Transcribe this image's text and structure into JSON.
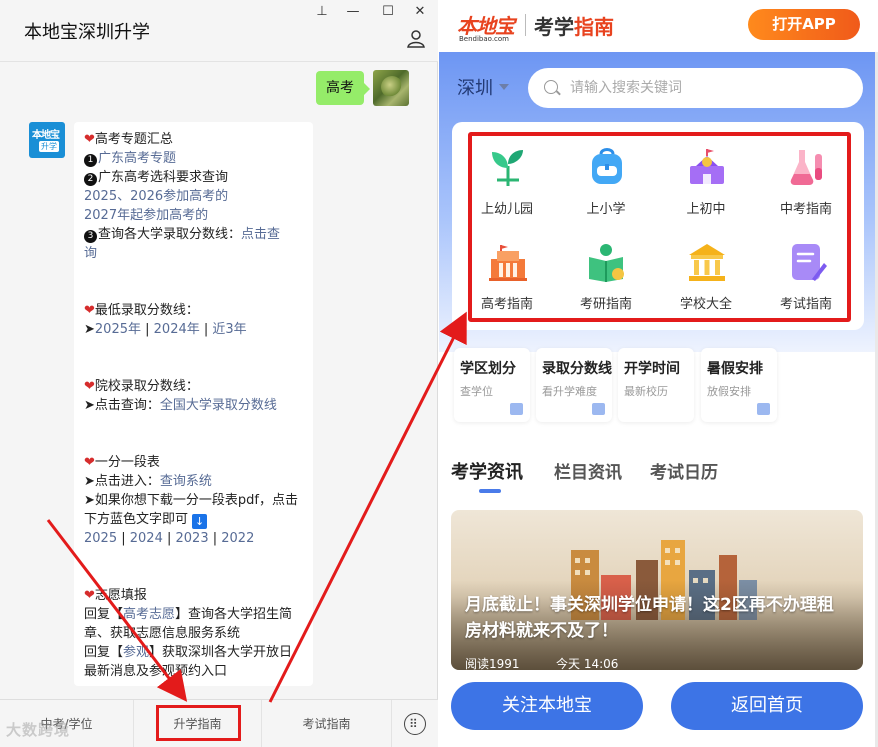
{
  "chat": {
    "title": "本地宝深圳升学",
    "window_controls": [
      "⊥",
      "—",
      "☐",
      "✕"
    ],
    "sent_message": "高考",
    "bot_avatar_text": [
      "本地宝",
      "升学"
    ],
    "lines": {
      "h1": "高考专题汇总",
      "l1": "广东高考专题",
      "l2": "广东高考选科要求查询",
      "l3": "2025、2026参加高考的",
      "l4": "2027年起参加高考的",
      "l5a": "查询各大学录取分数线：",
      "l5b": "点击查",
      "l5c": "询",
      "h2": "最低录取分数线：",
      "l6a": "➤",
      "l6b": "2025年",
      "l6c": "2024年",
      "l6d": "近3年",
      "h3": "院校录取分数线：",
      "l7a": "➤点击查询：",
      "l7b": "全国大学录取分数线",
      "h4": "一分一段表",
      "l8a": "➤点击进入：",
      "l8b": "查询系统",
      "l9": "➤如果你想下载一分一段表pdf，点击下方蓝色文字即可",
      "l10": [
        "2025",
        "2024",
        "2023",
        "2022"
      ],
      "h5": "志愿填报",
      "l11a": "回复【",
      "l11b": "高考志愿",
      "l11c": "】查询各大学招生简章、获取志愿信息服务系统",
      "l12a": "回复【",
      "l12b": "参观",
      "l12c": "】获取深圳各大学开放日最新消息及参观预约入口"
    },
    "bottom_tabs": [
      "中考/学位",
      "升学指南",
      "考试指南"
    ],
    "watermark": "大数跨境"
  },
  "site": {
    "logo_text": "本地宝",
    "logo_url": "Bendibao.com",
    "title_plain": "考学",
    "title_em": "指南",
    "open_app": "打开APP",
    "city": "深圳",
    "search_placeholder": "请输入搜索关键词",
    "grid": [
      {
        "label": "上幼儿园",
        "icon": "sprout-icon"
      },
      {
        "label": "上小学",
        "icon": "schoolbag-icon"
      },
      {
        "label": "上初中",
        "icon": "school-building-icon"
      },
      {
        "label": "中考指南",
        "icon": "flask-icon"
      },
      {
        "label": "高考指南",
        "icon": "factory-icon"
      },
      {
        "label": "考研指南",
        "icon": "book-globe-icon"
      },
      {
        "label": "学校大全",
        "icon": "temple-icon"
      },
      {
        "label": "考试指南",
        "icon": "notebook-pen-icon"
      }
    ],
    "quick": [
      {
        "title": "学区划分",
        "sub": "查学位"
      },
      {
        "title": "录取分数线",
        "sub": "看升学难度"
      },
      {
        "title": "开学时间",
        "sub": "最新校历"
      },
      {
        "title": "暑假安排",
        "sub": "放假安排"
      }
    ],
    "news_tabs": [
      "考学资讯",
      "栏目资讯",
      "考试日历"
    ],
    "article": {
      "headline": "月底截止！事关深圳学位申请！这2区再不办理租房材料就来不及了！",
      "reads": "阅读1991",
      "time": "今天 14:06"
    },
    "buttons": [
      "关注本地宝",
      "返回首页"
    ]
  },
  "colors": {
    "accent_blue": "#3d74e6",
    "annotation_red": "#e31b1b",
    "brand_orange": "#e8431f"
  }
}
